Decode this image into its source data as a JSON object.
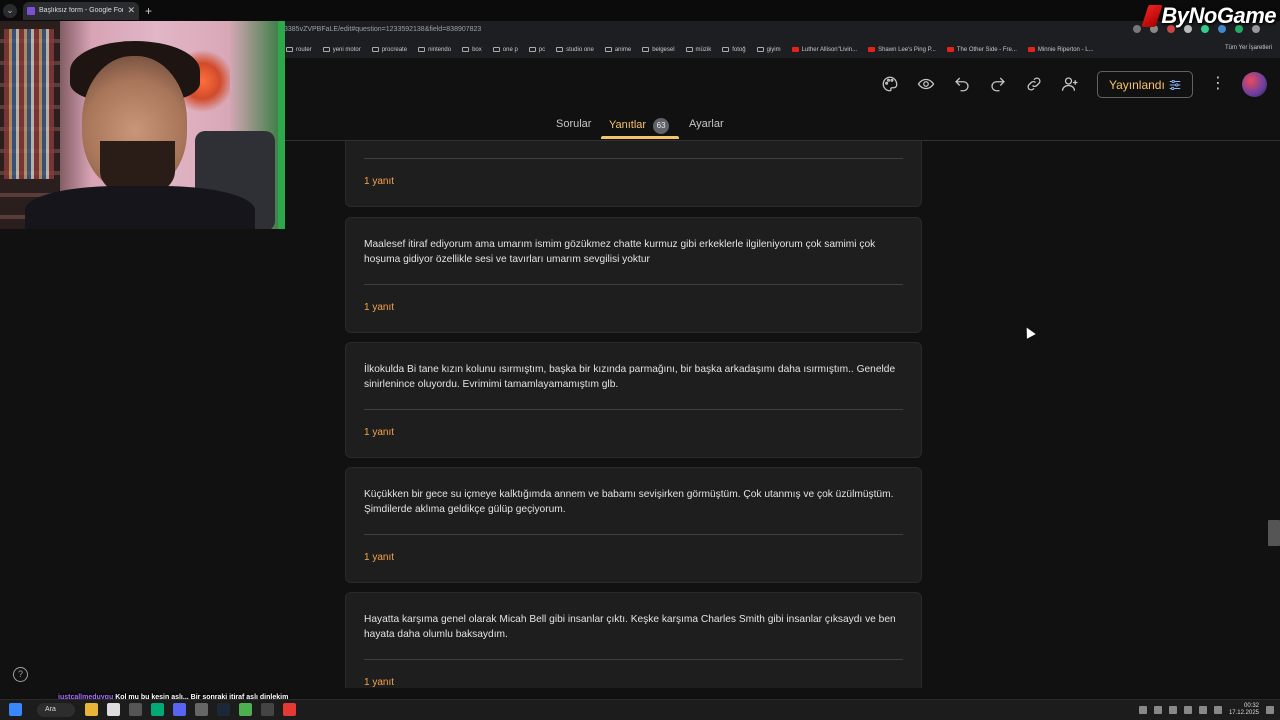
{
  "browser": {
    "tab_title": "Başlıksız form - Google Formlar",
    "url": "3385vZVPBFaLE/edit#question=1233592138&field=838907823",
    "bookmarks": [
      "router",
      "yeni motor",
      "procreate",
      "nintendo",
      "box",
      "one p",
      "pc",
      "studio one",
      "anime",
      "belgesel",
      "müzik",
      "fotoğ",
      "giyim",
      "Luther Allison\"Livin...",
      "Shawn Lee's Ping P...",
      "The Other Side - Fre...",
      "Minnie Riperton - L..."
    ],
    "bookmarks_right": "Tüm Yer İşaretleri",
    "new_tab_symbol": "+",
    "close_symbol": "✕"
  },
  "watermark": "ByNoGame",
  "header": {
    "publish_label": "Yayınlandı",
    "icons": [
      "palette-icon",
      "preview-eye-icon",
      "undo-icon",
      "redo-icon",
      "link-icon",
      "add-collaborator-icon"
    ],
    "kebab": "⋮"
  },
  "tabs": {
    "questions": "Sorular",
    "responses": "Yanıtlar",
    "responses_count": "63",
    "settings": "Ayarlar"
  },
  "cards": [
    {
      "answer": "",
      "count": "1 yanıt"
    },
    {
      "answer": "Maalesef itiraf ediyorum ama umarım ismim gözükmez chatte kurmuz gibi erkeklerle ilgileniyorum çok samimi çok hoşuma gidiyor özellikle sesi ve tavırları umarım sevgilisi yoktur",
      "count": "1 yanıt"
    },
    {
      "answer": "İlkokulda Bi tane kızın kolunu ısırmıştım, başka bir kızında parmağını, bir başka arkadaşımı daha ısırmıştım.. Genelde sinirlenince oluyordu. Evrimimi tamamlayamamıştım glb.",
      "count": "1 yanıt"
    },
    {
      "answer": "Küçükken bir gece su içmeye kalktığımda annem ve babamı sevişirken görmüştüm. Çok utanmış ve çok üzülmüştüm. Şimdilerde aklıma geldikçe gülüp geçiyorum.",
      "count": "1 yanıt"
    },
    {
      "answer": "Hayatta karşıma genel olarak Micah Bell gibi insanlar çıktı. Keşke karşıma Charles Smith gibi insanlar çıksaydı ve ben hayata daha olumlu baksaydım.",
      "count": "1 yanıt"
    }
  ],
  "help_symbol": "?",
  "chat": {
    "user": "justcallmeduygu",
    "message": "Kol mu bu kesin aslı... Bir sonraki itiraf aslı dinlekim"
  },
  "taskbar": {
    "search_label": "Ara",
    "time": "00:32",
    "date": "17.12.2025"
  },
  "colors": {
    "accent": "#f6c26b",
    "response_count": "#f6a34a",
    "card_bg": "#1e1e1e",
    "page_bg": "#111111"
  }
}
